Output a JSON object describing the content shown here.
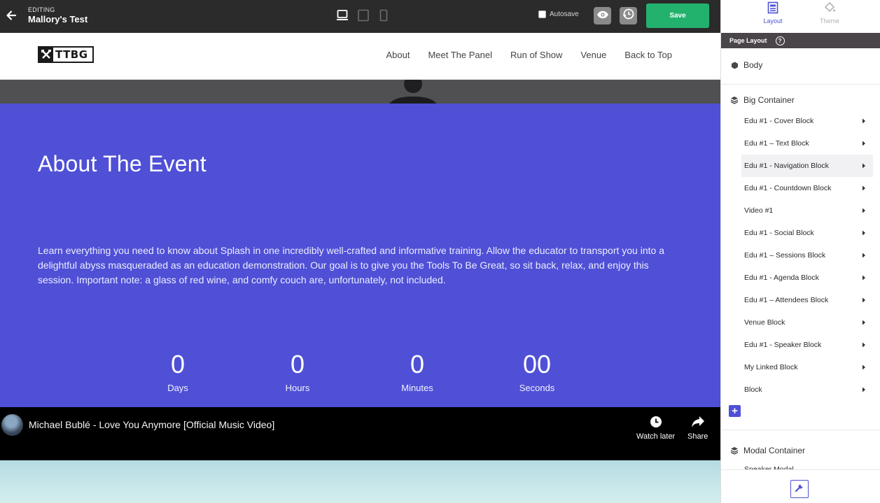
{
  "topbar": {
    "editing_label": "EDITING",
    "page_name": "Mallory's Test",
    "autosave_label": "Autosave",
    "save_label": "Save"
  },
  "site": {
    "logo_text": "TTBG",
    "nav": [
      "About",
      "Meet The Panel",
      "Run of Show",
      "Venue",
      "Back to Top"
    ]
  },
  "about": {
    "title": "About The Event",
    "body": "Learn everything you need to know about Splash in one incredibly well-crafted and informative training. Allow the educator to transport you into a delightful abyss masqueraded as an education demonstration. Our goal is to give you the Tools To Be Great, so sit back, relax, and enjoy this session. Important note: a glass of red wine, and comfy couch are, unfortunately, not included.",
    "countdown": [
      {
        "value": "0",
        "label": "Days"
      },
      {
        "value": "0",
        "label": "Hours"
      },
      {
        "value": "0",
        "label": "Minutes"
      },
      {
        "value": "00",
        "label": "Seconds"
      }
    ]
  },
  "video": {
    "title": "Michael Bublé - Love You Anymore [Official Music Video]",
    "watch_later": "Watch later",
    "share": "Share"
  },
  "panel": {
    "tab_layout": "Layout",
    "tab_theme": "Theme",
    "page_layout_label": "Page Layout",
    "help_glyph": "?",
    "body_label": "Body",
    "big_container_label": "Big Container",
    "blocks": [
      "Edu #1 - Cover Block",
      "Edu #1 – Text Block",
      "Edu #1 - Navigation Block",
      "Edu #1 - Countdown Block",
      "Video #1",
      "Edu #1 - Social Block",
      "Edu #1 – Sessions Block",
      "Edu #1 - Agenda Block",
      "Edu #1 – Attendees Block",
      "Venue Block",
      "Edu #1 - Speaker Block",
      "My Linked Block",
      "Block"
    ],
    "active_block_index": 2,
    "add_glyph": "+",
    "modal_container_label": "Modal Container",
    "modal_sub_label": "Speaker Modal"
  },
  "colors": {
    "accent": "#4f50d6",
    "save_green": "#23b26e",
    "topbar": "#2b2b2b"
  }
}
